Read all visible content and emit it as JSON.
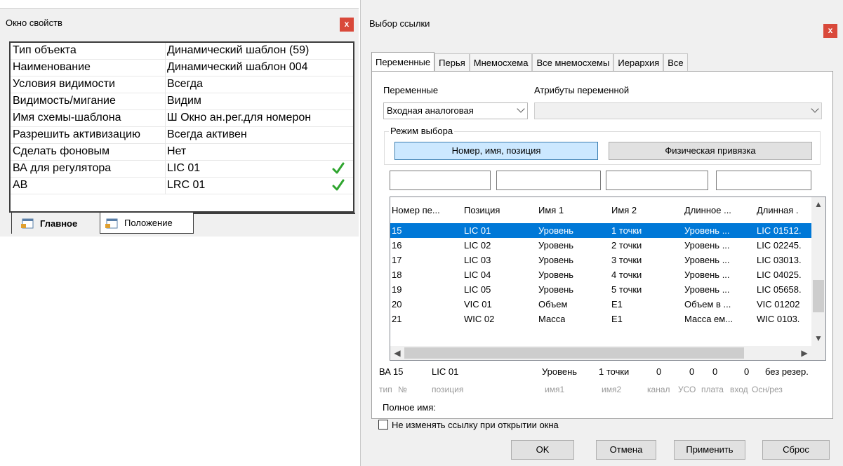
{
  "properties_window": {
    "title": "Окно свойств",
    "close_glyph": "x",
    "rows": [
      {
        "key": "Тип объекта",
        "value": "Динамический шаблон (59)"
      },
      {
        "key": "Наименование",
        "value": "Динамический шаблон 004"
      },
      {
        "key": "Условия видимости",
        "value": "Всегда"
      },
      {
        "key": "Видимость/мигание",
        "value": "Видим"
      },
      {
        "key": "Имя схемы-шаблона",
        "value": "Ш Окно ан.рег.для номерон"
      },
      {
        "key": "Разрешить активизацию",
        "value": "Всегда активен"
      },
      {
        "key": "Сделать фоновым",
        "value": "Нет"
      },
      {
        "key": "ВА для регулятора",
        "value": "LIC 01",
        "icon": "green-check-icon"
      },
      {
        "key": "АВ",
        "value": "LRC 01",
        "icon": "green-check-icon"
      }
    ],
    "tabs": {
      "main": "Главное",
      "position": "Положение"
    }
  },
  "dialog": {
    "title": "Выбор ссылки",
    "close_glyph": "x",
    "tabs": [
      "Переменные",
      "Перья",
      "Мнемосхема",
      "Все мнемосхемы",
      "Иерархия",
      "Все"
    ],
    "active_tab": "Переменные",
    "variables_label": "Переменные",
    "variables_value": "Входная аналоговая",
    "attributes_label": "Атрибуты переменной",
    "attributes_value": "",
    "mode_label": "Режим выбора",
    "mode_buttons": {
      "number_name_position": "Номер, имя, позиция",
      "physical_binding": "Физическая привязка"
    },
    "mode_selected": "Номер, имя, позиция",
    "filters": [
      "",
      "",
      "",
      ""
    ],
    "columns": [
      "Номер пе...",
      "Позиция",
      "Имя 1",
      "Имя 2",
      "Длинное ...",
      "Длинная ."
    ],
    "rows": [
      [
        "15",
        "LIC 01",
        "Уровень",
        "1 точки",
        "Уровень ...",
        "LIC 01512."
      ],
      [
        "16",
        "LIC 02",
        "Уровень",
        "2 точки",
        "Уровень ...",
        "LIC 02245."
      ],
      [
        "17",
        "LIC 03",
        "Уровень",
        "3 точки",
        "Уровень ...",
        "LIC 03013."
      ],
      [
        "18",
        "LIC 04",
        "Уровень",
        "4 точки",
        "Уровень ...",
        "LIC 04025."
      ],
      [
        "19",
        "LIC 05",
        "Уровень",
        "5 точки",
        "Уровень ...",
        "LIC 05658."
      ],
      [
        "20",
        "VIC 01",
        "Объем",
        "E1",
        "Объем в ...",
        "VIC 01202"
      ],
      [
        "21",
        "WIC 02",
        "Масса",
        "E1",
        "Масса ем...",
        "WIC 0103."
      ]
    ],
    "selected_row_index": 0,
    "summary": {
      "type": "ВА",
      "number": "15",
      "position": "LIC 01",
      "name1": "Уровень",
      "name2": "1 точки",
      "channel": "0",
      "uso": "0",
      "board": "0",
      "input": "0",
      "reserve": "без резер."
    },
    "summary_labels": {
      "type": "тип",
      "number": "№",
      "position": "позиция",
      "name1": "имя1",
      "name2": "имя2",
      "channel": "канал",
      "uso": "УСО",
      "board": "плата",
      "input": "вход",
      "reserve": "Осн/рез"
    },
    "full_name_label": "Полное имя:",
    "full_name_value": "",
    "keep_link_checkbox": {
      "label": "Не изменять ссылку при открытии окна",
      "checked": false
    },
    "buttons": {
      "ok": "OK",
      "cancel": "Отмена",
      "apply": "Применить",
      "reset": "Сброс"
    }
  },
  "colors": {
    "close": "#d9493a",
    "selection": "#0078d7",
    "mode_selected": "#cce8ff",
    "check": "#2fa52f"
  }
}
